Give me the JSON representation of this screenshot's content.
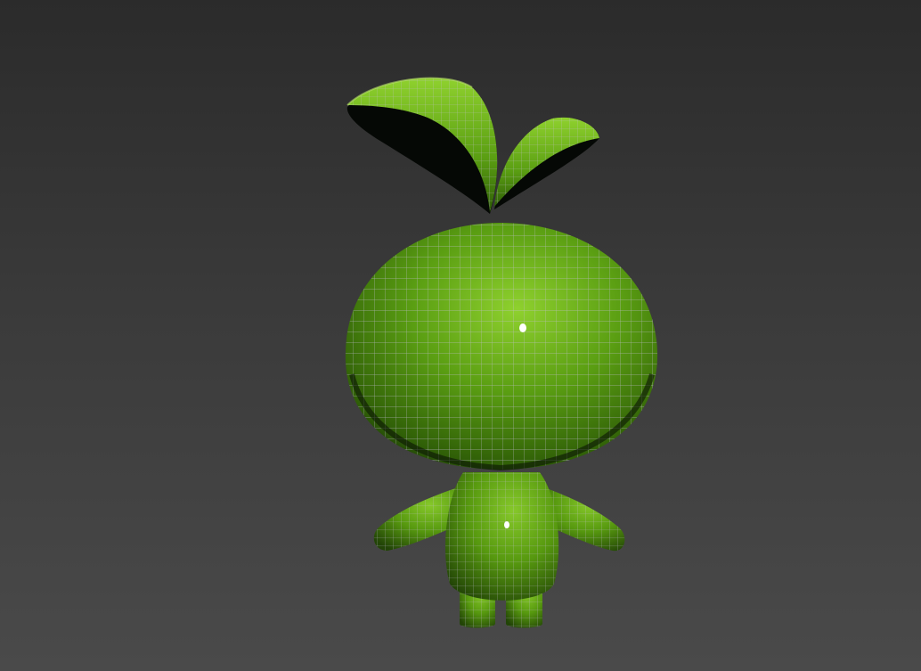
{
  "viewport": {
    "background_top": "#2b2b2b",
    "background_bottom": "#4a4a4a"
  },
  "model": {
    "base_color": "#5a9e12",
    "highlight_color": "#8fd12e",
    "shadow_color": "#1e3a05",
    "wireframe_color": "#b8b0cc",
    "parts": [
      "left-leaf",
      "right-leaf",
      "head",
      "body",
      "left-arm",
      "right-arm",
      "left-leg",
      "right-leg"
    ]
  }
}
